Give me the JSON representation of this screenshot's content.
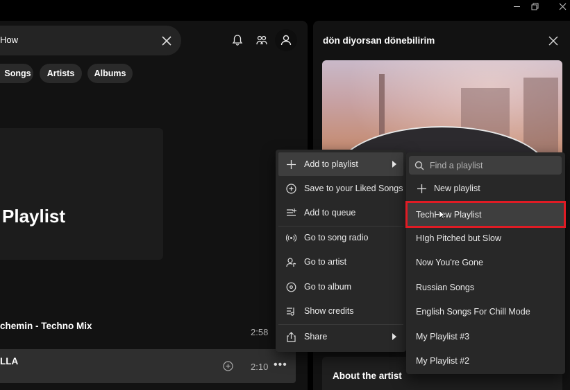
{
  "window": {
    "minimize": "—",
    "restore": "❐",
    "close": "✕"
  },
  "search": {
    "value": "How"
  },
  "filters": [
    "Songs",
    "Artists",
    "Albums"
  ],
  "hero": {
    "title": "Playlist"
  },
  "tracks": [
    {
      "title": "chemin - Techno Mix",
      "duration": "2:58"
    },
    {
      "title": "LLA",
      "duration": "2:10",
      "more": "•••"
    }
  ],
  "now_playing_panel": {
    "title": "dön diyorsan dönebilirim",
    "about_label": "About the artist"
  },
  "context_menu": {
    "items": [
      {
        "label": "Add to playlist",
        "icon": "plus-icon",
        "has_submenu": true
      },
      {
        "label": "Save to your Liked Songs",
        "icon": "add-circle-icon"
      },
      {
        "label": "Add to queue",
        "icon": "queue-icon"
      },
      {
        "label": "Go to song radio",
        "icon": "radio-icon"
      },
      {
        "label": "Go to artist",
        "icon": "artist-icon"
      },
      {
        "label": "Go to album",
        "icon": "album-icon"
      },
      {
        "label": "Show credits",
        "icon": "credits-icon"
      },
      {
        "label": "Share",
        "icon": "share-icon",
        "has_submenu": true
      }
    ]
  },
  "playlist_submenu": {
    "search_placeholder": "Find a playlist",
    "new_playlist": "New playlist",
    "playlists": [
      "TechHow Playlist",
      "HIgh Pitched but Slow",
      "Now You're Gone",
      "Russian Songs",
      "English Songs For Chill Mode",
      "My Playlist #3",
      "My Playlist #2"
    ]
  },
  "colors": {
    "highlight_border": "#e01b24",
    "menu_bg": "#282828",
    "app_bg": "#121212"
  }
}
